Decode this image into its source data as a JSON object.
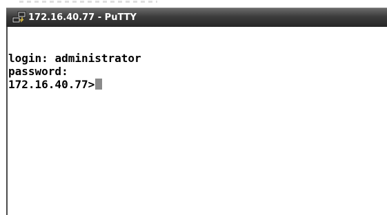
{
  "window": {
    "title": "172.16.40.77 - PuTTY",
    "icon": "putty-icon"
  },
  "terminal": {
    "lines": [
      {
        "label": "login: ",
        "value": "administrator"
      },
      {
        "label": "password:",
        "value": ""
      },
      {
        "label": "172.16.40.77>",
        "value": ""
      }
    ],
    "cursor_color": "#8a8a8a",
    "background": "#ffffff",
    "foreground": "#000000"
  },
  "colors": {
    "titlebar": "#3c3c3c",
    "title_text": "#ffffff"
  }
}
